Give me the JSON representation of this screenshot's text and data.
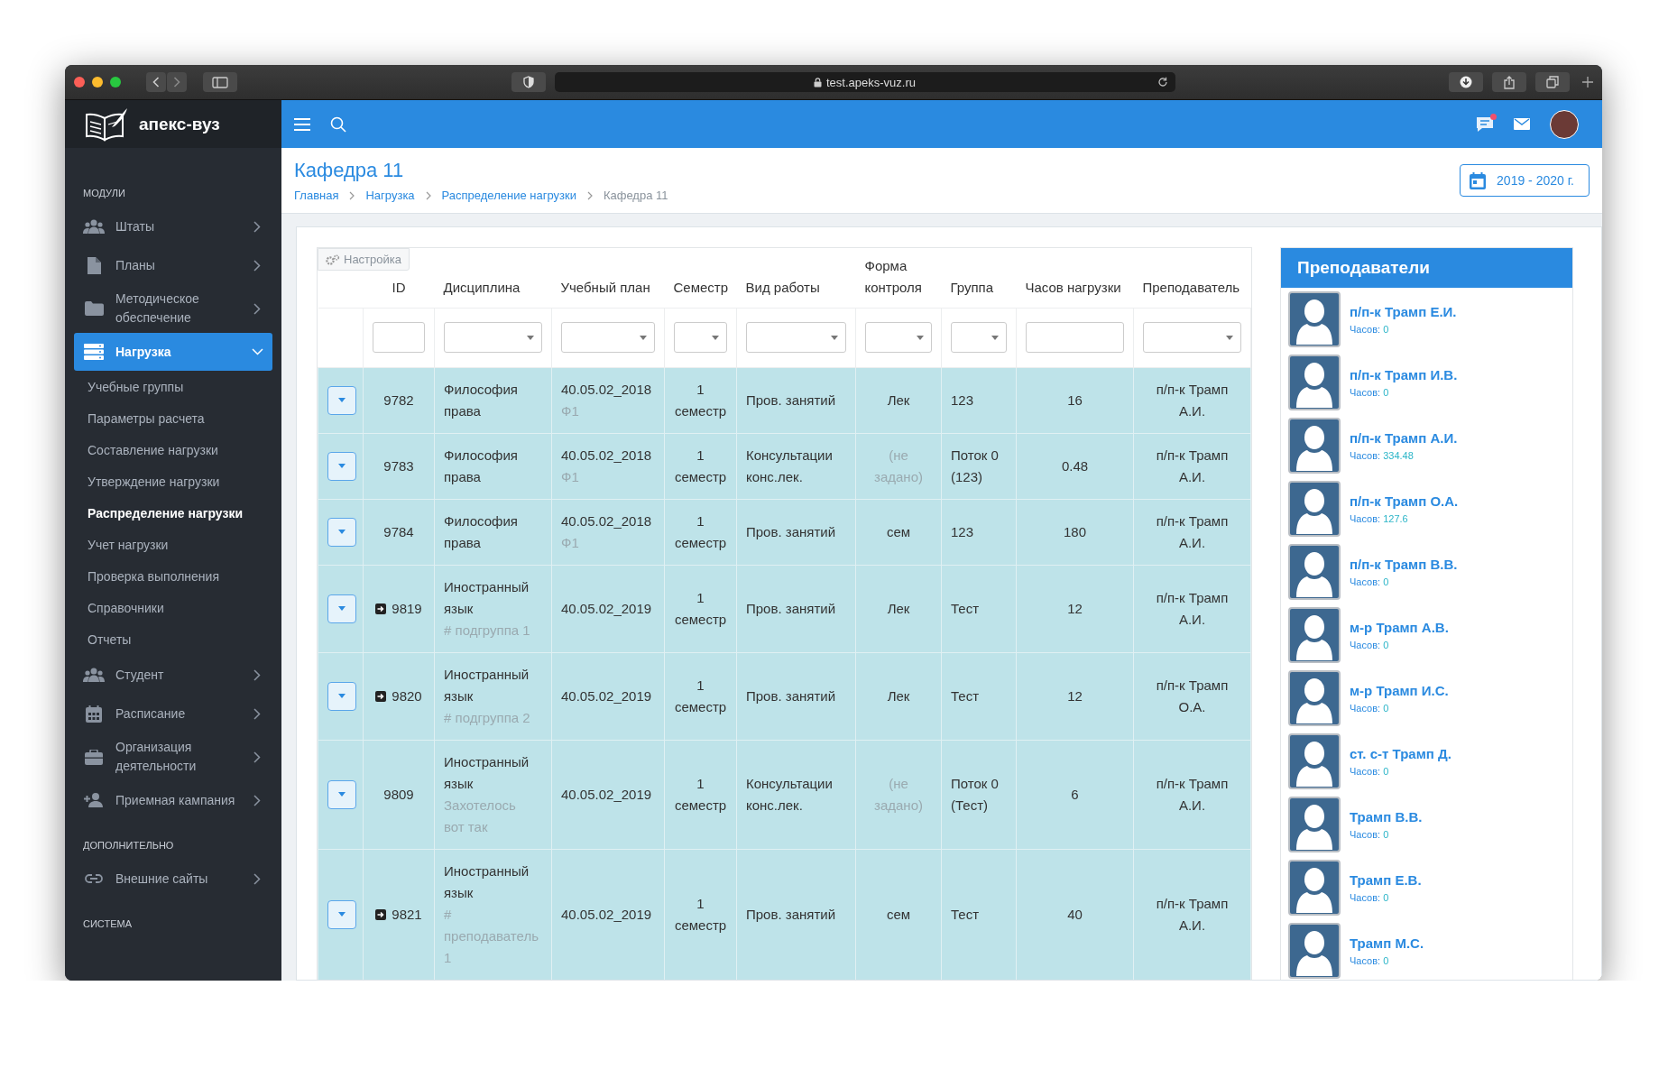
{
  "browser": {
    "url": "test.apeks-vuz.ru"
  },
  "logo": {
    "text": "апекс-вуз"
  },
  "sidebar": {
    "sections": [
      {
        "title": "МОДУЛИ",
        "items": [
          {
            "label": "Штаты",
            "selected": false,
            "expanded": false
          },
          {
            "label": "Планы",
            "selected": false,
            "expanded": false
          },
          {
            "label": "Методическое обеспечение",
            "selected": false,
            "expanded": false
          },
          {
            "label": "Нагрузка",
            "selected": true,
            "expanded": true,
            "children": [
              {
                "label": "Учебные группы",
                "selected": false
              },
              {
                "label": "Параметры расчета",
                "selected": false
              },
              {
                "label": "Составление нагрузки",
                "selected": false
              },
              {
                "label": "Утверждение нагрузки",
                "selected": false
              },
              {
                "label": "Распределение нагрузки",
                "selected": true
              },
              {
                "label": "Учет нагрузки",
                "selected": false
              },
              {
                "label": "Проверка выполнения",
                "selected": false
              },
              {
                "label": "Справочники",
                "selected": false
              },
              {
                "label": "Отчеты",
                "selected": false
              }
            ]
          },
          {
            "label": "Студент",
            "selected": false,
            "expanded": false
          },
          {
            "label": "Расписание",
            "selected": false,
            "expanded": false
          },
          {
            "label": "Организация деятельности",
            "selected": false,
            "expanded": false
          },
          {
            "label": "Приемная кампания",
            "selected": false,
            "expanded": false
          }
        ]
      },
      {
        "title": "ДОПОЛНИТЕЛЬНО",
        "items": [
          {
            "label": "Внешние сайты",
            "selected": false,
            "expanded": false
          }
        ]
      },
      {
        "title": "СИСТЕМА"
      }
    ]
  },
  "header": {
    "notification": true
  },
  "page": {
    "title": "Кафедра 11",
    "breadcrumbs": [
      {
        "label": "Главная",
        "link": true
      },
      {
        "label": "Нагрузка",
        "link": true
      },
      {
        "label": "Распределение нагрузки",
        "link": true
      },
      {
        "label": "Кафедра 11",
        "link": false
      }
    ],
    "year_button": "2019 - 2020 г."
  },
  "table": {
    "settings_button": "Настройка",
    "columns": [
      {
        "label": "ID",
        "kind": "text"
      },
      {
        "label": "Дисциплина",
        "kind": "select"
      },
      {
        "label": "Учебный план",
        "kind": "select"
      },
      {
        "label": "Семестр",
        "kind": "select"
      },
      {
        "label": "Вид работы",
        "kind": "select"
      },
      {
        "label": "Форма контроля",
        "kind": "select"
      },
      {
        "label": "Группа",
        "kind": "select"
      },
      {
        "label": "Часов нагрузки",
        "kind": "text"
      },
      {
        "label": "Преподаватель",
        "kind": "select"
      }
    ],
    "rows": [
      {
        "id": "9782",
        "linked": false,
        "discipline": "Философия права",
        "plan": "40.05.02_2018",
        "plan_note": "Ф1",
        "semester": "1 семестр",
        "work_type": "Пров. занятий",
        "control": "Лек",
        "control_unset": false,
        "group": "123",
        "hours": "16",
        "teacher": "п/п-к Трамп А.И."
      },
      {
        "id": "9783",
        "linked": false,
        "discipline": "Философия права",
        "plan": "40.05.02_2018",
        "plan_note": "Ф1",
        "semester": "1 семестр",
        "work_type": "Консультации конс.лек.",
        "control": "(не задано)",
        "control_unset": true,
        "group": "Поток 0 (123)",
        "hours": "0.48",
        "teacher": "п/п-к Трамп А.И."
      },
      {
        "id": "9784",
        "linked": false,
        "discipline": "Философия права",
        "plan": "40.05.02_2018",
        "plan_note": "Ф1",
        "semester": "1 семестр",
        "work_type": "Пров. занятий",
        "control": "сем",
        "control_unset": false,
        "group": "123",
        "hours": "180",
        "teacher": "п/п-к Трамп А.И."
      },
      {
        "id": "9819",
        "linked": true,
        "discipline": "Иностранный язык",
        "discipline_note": "# подгруппа 1",
        "plan": "40.05.02_2019",
        "semester": "1 семестр",
        "work_type": "Пров. занятий",
        "control": "Лек",
        "control_unset": false,
        "group": "Тест",
        "hours": "12",
        "teacher": "п/п-к Трамп А.И."
      },
      {
        "id": "9820",
        "linked": true,
        "discipline": "Иностранный язык",
        "discipline_note": "# подгруппа 2",
        "plan": "40.05.02_2019",
        "semester": "1 семестр",
        "work_type": "Пров. занятий",
        "control": "Лек",
        "control_unset": false,
        "group": "Тест",
        "hours": "12",
        "teacher": "п/п-к Трамп О.А."
      },
      {
        "id": "9809",
        "linked": false,
        "discipline": "Иностранный язык",
        "discipline_note": "Захотелось вот так",
        "plan": "40.05.02_2019",
        "semester": "1 семестр",
        "work_type": "Консультации конс.лек.",
        "control": "(не задано)",
        "control_unset": true,
        "group": "Поток 0 (Тест)",
        "hours": "6",
        "teacher": "п/п-к Трамп А.И."
      },
      {
        "id": "9821",
        "linked": true,
        "discipline": "Иностранный язык",
        "discipline_note": "# преподаватель 1",
        "plan": "40.05.02_2019",
        "semester": "1 семестр",
        "work_type": "Пров. занятий",
        "control": "сем",
        "control_unset": false,
        "group": "Тест",
        "hours": "40",
        "teacher": "п/п-к Трамп А.И."
      }
    ]
  },
  "teachers": {
    "title": "Преподаватели",
    "items": [
      {
        "name": "п/п-к Трамп Е.И.",
        "hours_label": "Часов:",
        "hours": "0"
      },
      {
        "name": "п/п-к Трамп И.В.",
        "hours_label": "Часов:",
        "hours": "0"
      },
      {
        "name": "п/п-к Трамп А.И.",
        "hours_label": "Часов:",
        "hours": "334.48"
      },
      {
        "name": "п/п-к Трамп О.А.",
        "hours_label": "Часов:",
        "hours": "127.6"
      },
      {
        "name": "п/п-к Трамп В.В.",
        "hours_label": "Часов:",
        "hours": "0"
      },
      {
        "name": "м-р Трамп А.В.",
        "hours_label": "Часов:",
        "hours": "0"
      },
      {
        "name": "м-р Трамп И.С.",
        "hours_label": "Часов:",
        "hours": "0"
      },
      {
        "name": "ст. с-т Трамп Д.",
        "hours_label": "Часов:",
        "hours": "0"
      },
      {
        "name": "Трамп В.В.",
        "hours_label": "Часов:",
        "hours": "0"
      },
      {
        "name": "Трамп Е.В.",
        "hours_label": "Часов:",
        "hours": "0"
      },
      {
        "name": "Трамп М.С.",
        "hours_label": "Часов:",
        "hours": "0"
      }
    ]
  }
}
